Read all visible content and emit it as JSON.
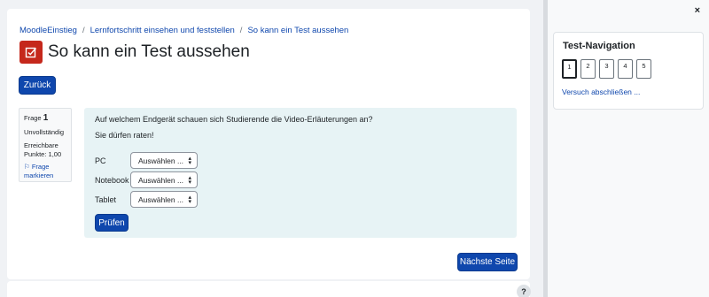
{
  "breadcrumb": {
    "items": [
      "MoodleEinstieg",
      "Lernfortschritt einsehen und feststellen",
      "So kann ein Test aussehen"
    ],
    "separator": "/"
  },
  "page": {
    "title": "So kann ein Test aussehen",
    "icon": "quiz-checkbox-icon",
    "icon_color": "#c5281c"
  },
  "buttons": {
    "back": "Zurück",
    "check": "Prüfen",
    "next": "Nächste Seite",
    "help": "?"
  },
  "question_info": {
    "number_label": "Frage",
    "number": "1",
    "state": "Unvollständig",
    "marks": "Erreichbare Punkte: 1,00",
    "flag": "Frage markieren"
  },
  "question": {
    "text": "Auf welchem Endgerät schauen sich Studierende die Video-Erläuterungen an?",
    "hint": "Sie dürfen raten!",
    "rows": [
      {
        "label": "PC",
        "selected": "Auswählen ..."
      },
      {
        "label": "Notebook",
        "selected": "Auswählen ..."
      },
      {
        "label": "Tablet",
        "selected": "Auswählen ..."
      }
    ]
  },
  "drawer": {
    "close": "×",
    "title": "Test-Navigation",
    "questions": [
      "1",
      "2",
      "3",
      "4",
      "5"
    ],
    "current_question": "1",
    "finish_link": "Versuch abschließen ..."
  },
  "colors": {
    "primary": "#0f47ad",
    "question_bg": "#e7f3f5"
  }
}
